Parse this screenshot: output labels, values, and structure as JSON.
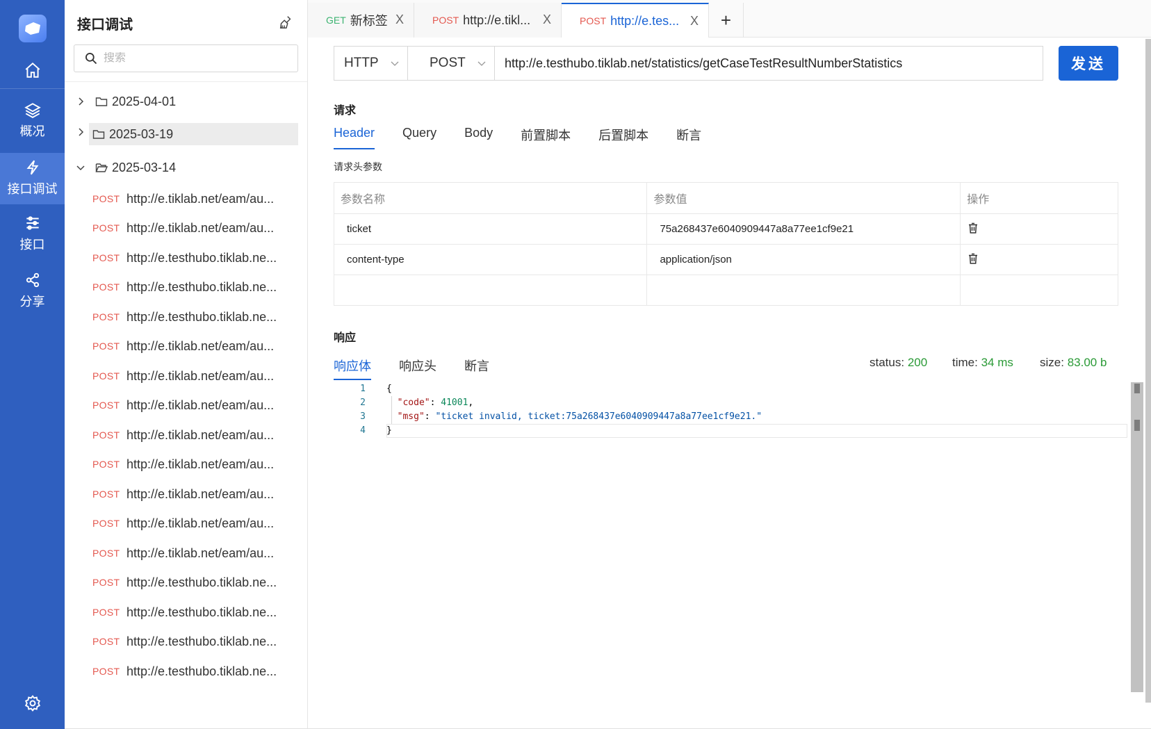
{
  "nav": {
    "items": [
      {
        "label": "",
        "icon": "home-icon"
      },
      {
        "label": "概况",
        "icon": "layers-icon"
      },
      {
        "label": "接口调试",
        "icon": "lightning-icon"
      },
      {
        "label": "接口",
        "icon": "sliders-icon"
      },
      {
        "label": "分享",
        "icon": "share-icon"
      }
    ],
    "settings_icon": "gear-icon"
  },
  "tree": {
    "title": "接口调试",
    "search_placeholder": "搜索",
    "folders": [
      {
        "name": "2025-04-01",
        "expanded": false
      },
      {
        "name": "2025-03-19",
        "expanded": false,
        "selected": true
      },
      {
        "name": "2025-03-14",
        "expanded": true
      }
    ],
    "requests": [
      {
        "method": "POST",
        "url": "http://e.tiklab.net/eam/au..."
      },
      {
        "method": "POST",
        "url": "http://e.tiklab.net/eam/au..."
      },
      {
        "method": "POST",
        "url": "http://e.testhubo.tiklab.ne..."
      },
      {
        "method": "POST",
        "url": "http://e.testhubo.tiklab.ne..."
      },
      {
        "method": "POST",
        "url": "http://e.testhubo.tiklab.ne..."
      },
      {
        "method": "POST",
        "url": "http://e.tiklab.net/eam/au..."
      },
      {
        "method": "POST",
        "url": "http://e.tiklab.net/eam/au..."
      },
      {
        "method": "POST",
        "url": "http://e.tiklab.net/eam/au..."
      },
      {
        "method": "POST",
        "url": "http://e.tiklab.net/eam/au..."
      },
      {
        "method": "POST",
        "url": "http://e.tiklab.net/eam/au..."
      },
      {
        "method": "POST",
        "url": "http://e.tiklab.net/eam/au..."
      },
      {
        "method": "POST",
        "url": "http://e.tiklab.net/eam/au..."
      },
      {
        "method": "POST",
        "url": "http://e.tiklab.net/eam/au..."
      },
      {
        "method": "POST",
        "url": "http://e.testhubo.tiklab.ne..."
      },
      {
        "method": "POST",
        "url": "http://e.testhubo.tiklab.ne..."
      },
      {
        "method": "POST",
        "url": "http://e.testhubo.tiklab.ne..."
      },
      {
        "method": "POST",
        "url": "http://e.testhubo.tiklab.ne..."
      }
    ]
  },
  "tabs": [
    {
      "method": "GET",
      "title": "新标签",
      "close": "X",
      "method_color": "#3cb371"
    },
    {
      "method": "POST",
      "title": "http://e.tikl...",
      "close": "X",
      "method_color": "#e4584f"
    },
    {
      "method": "POST",
      "title": "http://e.tes...",
      "close": "X",
      "method_color": "#e4584f",
      "active": true
    }
  ],
  "tab_add": "+",
  "request_bar": {
    "protocol": "HTTP",
    "method": "POST",
    "url": "http://e.testhubo.tiklab.net/statistics/getCaseTestResultNumberStatistics",
    "send_label": "发送"
  },
  "request": {
    "heading": "请求",
    "tabs": [
      "Header",
      "Query",
      "Body",
      "前置脚本",
      "后置脚本",
      "断言"
    ],
    "active_tab": "Header",
    "header_params_label": "请求头参数",
    "columns": [
      "参数名称",
      "参数值",
      "操作"
    ],
    "rows": [
      {
        "name": "ticket",
        "value": "75a268437e6040909447a8a77ee1cf9e21"
      },
      {
        "name": "content-type",
        "value": "application/json"
      }
    ]
  },
  "response": {
    "heading": "响应",
    "tabs": [
      "响应体",
      "响应头",
      "断言"
    ],
    "active_tab": "响应体",
    "status_label": "status:",
    "status_value": "200",
    "time_label": "time:",
    "time_value": "34 ms",
    "size_label": "size:",
    "size_value": "83.00 b",
    "lines": [
      "1",
      "2",
      "3",
      "4"
    ],
    "body": {
      "open": "{",
      "code_key": "\"code\"",
      "code_value": "41001",
      "msg_key": "\"msg\"",
      "msg_value": "\"ticket invalid, ticket:75a268437e6040909447a8a77ee1cf9e21.\"",
      "close": "}"
    }
  },
  "colors": {
    "nav_bg": "#2f5fbf",
    "accent": "#1a64d6",
    "post_method": "#e4584f",
    "get_method": "#3cb371",
    "status_ok": "#2a9a36"
  }
}
